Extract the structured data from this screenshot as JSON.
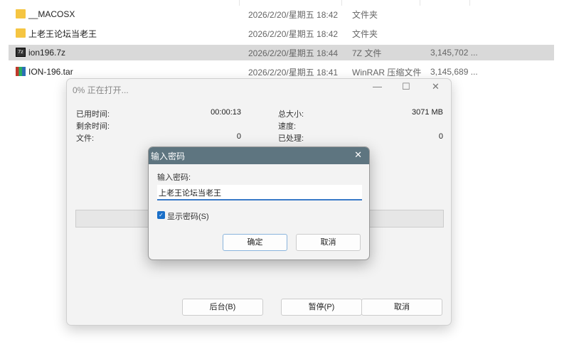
{
  "files": [
    {
      "name": "__MACOSX",
      "date": "2026/2/20/星期五 18:42",
      "type": "文件夹",
      "size": "",
      "icon": "folder-icon"
    },
    {
      "name": "上老王论坛当老王",
      "date": "2026/2/20/星期五 18:42",
      "type": "文件夹",
      "size": "",
      "icon": "folder-icon"
    },
    {
      "name": "ion196.7z",
      "date": "2026/2/20/星期五 18:44",
      "type": "7Z 文件",
      "size": "3,145,702 ...",
      "icon": "7z-icon"
    },
    {
      "name": "ION-196.tar",
      "date": "2026/2/20/星期五 18:41",
      "type": "WinRAR 压缩文件",
      "size": "3,145,689 ...",
      "icon": "winrar-icon"
    }
  ],
  "progress": {
    "title": "0% 正在打开...",
    "elapsed_label": "已用时间:",
    "elapsed": "00:00:13",
    "remaining_label": "剩余时间:",
    "files_label": "文件:",
    "files": "0",
    "total_label": "总大小:",
    "total": "3071 MB",
    "speed_label": "速度:",
    "processed_label": "已处理:",
    "processed": "0",
    "background_btn": "后台(B)",
    "pause_btn": "暂停(P)",
    "cancel_btn": "取消",
    "percent": 0
  },
  "password_dialog": {
    "title": "输入密码",
    "prompt": "输入密码:",
    "value": "上老王论坛当老王",
    "show_password": "显示密码(S)",
    "show_checked": true,
    "ok": "确定",
    "cancel": "取消"
  }
}
